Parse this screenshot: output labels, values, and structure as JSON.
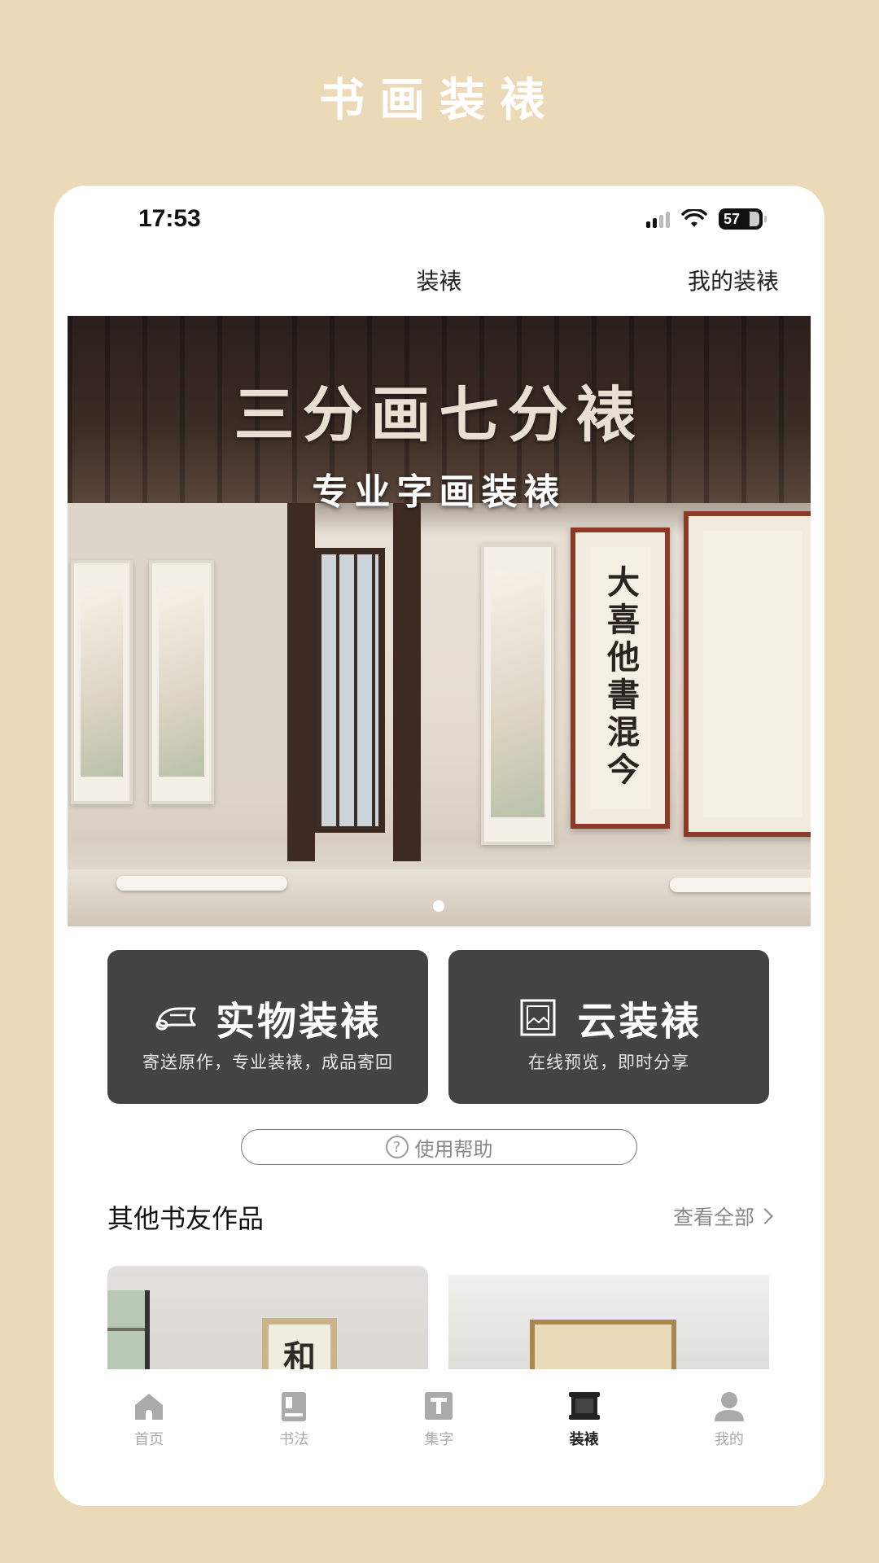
{
  "header": {
    "title": "书画装裱"
  },
  "status_bar": {
    "time": "17:53",
    "battery": "57"
  },
  "top_nav": {
    "tab_main": "装裱",
    "tab_mine": "我的装裱"
  },
  "banner": {
    "title": "三分画七分裱",
    "subtitle": "专业字画装裱",
    "calligraphy_main": "大喜他書混今",
    "page_indicator": "1"
  },
  "services": [
    {
      "title": "实物装裱",
      "desc": "寄送原作，专业装裱，成品寄回",
      "icon": "scroll-icon"
    },
    {
      "title": "云装裱",
      "desc": "在线预览，即时分享",
      "icon": "frame-icon"
    }
  ],
  "help": {
    "label": "使用帮助"
  },
  "works_section": {
    "title": "其他书友作品",
    "view_all": "查看全部"
  },
  "works": [
    {
      "char": "和"
    }
  ],
  "tab_bar": [
    {
      "label": "首页",
      "icon": "home-icon",
      "active": false
    },
    {
      "label": "书法",
      "icon": "book-icon",
      "active": false
    },
    {
      "label": "集字",
      "icon": "text-icon",
      "active": false
    },
    {
      "label": "装裱",
      "icon": "scroll-frame-icon",
      "active": true
    },
    {
      "label": "我的",
      "icon": "user-icon",
      "active": false
    }
  ],
  "colors": {
    "background": "#ecd9b8",
    "card": "#434343",
    "active_tab": "#222222",
    "inactive_tab": "#aaaaaa"
  }
}
